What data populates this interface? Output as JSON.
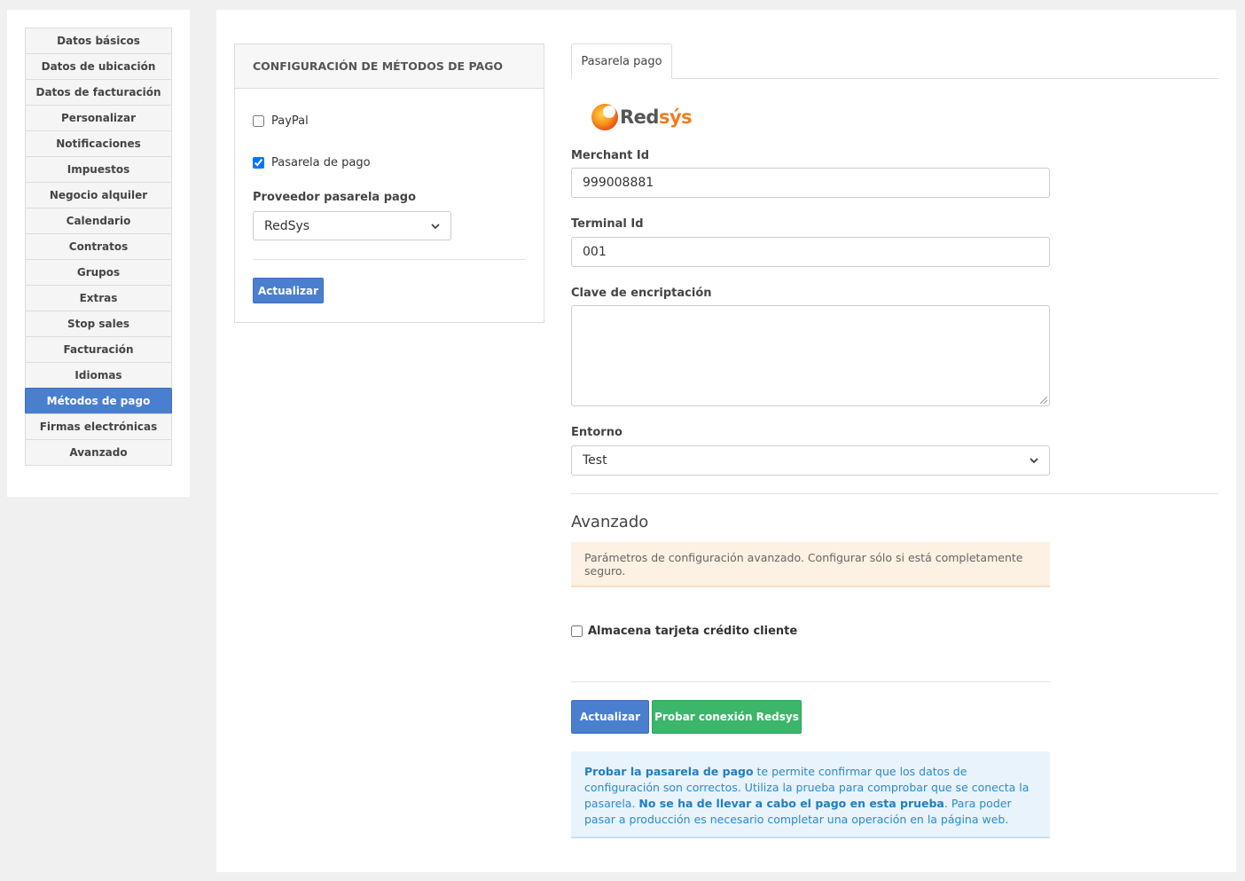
{
  "sidebar": {
    "items": [
      {
        "label": "Datos básicos",
        "active": false
      },
      {
        "label": "Datos de ubicación",
        "active": false
      },
      {
        "label": "Datos de facturación",
        "active": false
      },
      {
        "label": "Personalizar",
        "active": false
      },
      {
        "label": "Notificaciones",
        "active": false
      },
      {
        "label": "Impuestos",
        "active": false
      },
      {
        "label": "Negocio alquiler",
        "active": false
      },
      {
        "label": "Calendario",
        "active": false
      },
      {
        "label": "Contratos",
        "active": false
      },
      {
        "label": "Grupos",
        "active": false
      },
      {
        "label": "Extras",
        "active": false
      },
      {
        "label": "Stop sales",
        "active": false
      },
      {
        "label": "Facturación",
        "active": false
      },
      {
        "label": "Idiomas",
        "active": false
      },
      {
        "label": "Métodos de pago",
        "active": true
      },
      {
        "label": "Firmas electrónicas",
        "active": false
      },
      {
        "label": "Avanzado",
        "active": false
      }
    ]
  },
  "config": {
    "title": "CONFIGURACIÓN DE MÉTODOS DE PAGO",
    "paypal_label": "PayPal",
    "paypal_checked": false,
    "gateway_label": "Pasarela de pago",
    "gateway_checked": true,
    "provider_label": "Proveedor pasarela pago",
    "provider_value": "RedSys",
    "update_button": "Actualizar"
  },
  "gateway": {
    "tab_label": "Pasarela pago",
    "logo_text_part1": "Red",
    "logo_text_part2": "sýs",
    "merchant_label": "Merchant Id",
    "merchant_value": "999008881",
    "terminal_label": "Terminal Id",
    "terminal_value": "001",
    "key_label": "Clave de encriptación",
    "key_value": "",
    "env_label": "Entorno",
    "env_value": "Test",
    "advanced_title": "Avanzado",
    "advanced_warning": "Parámetros de configuración avanzado. Configurar sólo si está completamente seguro.",
    "store_card_label": "Almacena tarjeta crédito cliente",
    "store_card_checked": false,
    "update_button": "Actualizar",
    "test_button": "Probar conexión Redsys",
    "info_bold1": "Probar la pasarela de pago",
    "info_text1": " te permite confirmar que los datos de configuración son correctos. Utiliza la prueba para comprobar que se conecta la pasarela. ",
    "info_bold2": "No se ha de llevar a cabo el pago en esta prueba",
    "info_text2": ". Para poder pasar a producción es necesario completar una operación en la página web."
  },
  "colors": {
    "accent_blue": "#4a7fd0",
    "success_green": "#3cb66a",
    "warning_bg": "#fcf1e2",
    "info_bg": "#e8f3fc",
    "logo_orange": "#f07d1a"
  }
}
